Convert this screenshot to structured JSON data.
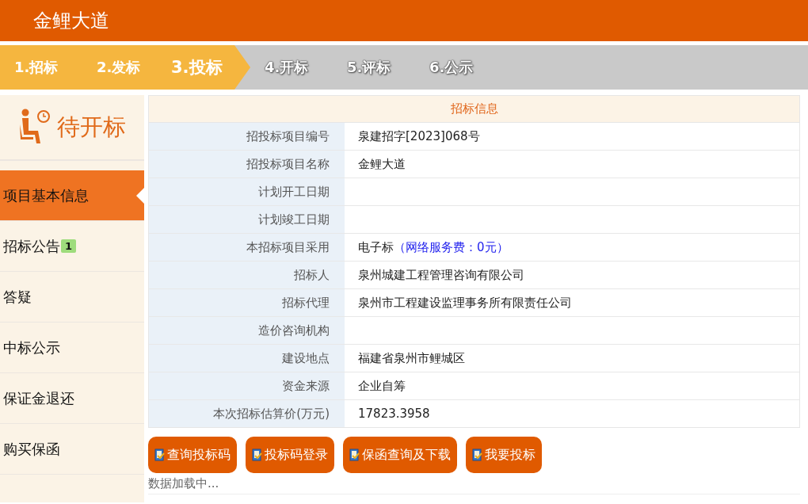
{
  "header": {
    "title": "金鲤大道"
  },
  "steps": [
    {
      "label": "1.招标",
      "reached": true,
      "selected": false
    },
    {
      "label": "2.发标",
      "reached": true,
      "selected": false
    },
    {
      "label": "3.投标",
      "reached": true,
      "selected": true
    },
    {
      "label": "4.开标",
      "reached": false,
      "selected": false
    },
    {
      "label": "5.评标",
      "reached": false,
      "selected": false
    },
    {
      "label": "6.公示",
      "reached": false,
      "selected": false
    }
  ],
  "status_card": {
    "label": "待开标"
  },
  "sidebar": {
    "items": [
      {
        "label": "项目基本信息",
        "selected": true
      },
      {
        "label": "招标公告",
        "selected": false,
        "badge": "1"
      },
      {
        "label": "答疑",
        "selected": false
      },
      {
        "label": "中标公示",
        "selected": false
      },
      {
        "label": "保证金退还",
        "selected": false
      },
      {
        "label": "购买保函",
        "selected": false
      }
    ]
  },
  "table": {
    "title": "招标信息",
    "rows": [
      {
        "label": "招投标项目编号",
        "value": "泉建招字[2023]068号"
      },
      {
        "label": "招投标项目名称",
        "value": "金鲤大道"
      },
      {
        "label": "计划开工日期"
      },
      {
        "label": "计划竣工日期"
      },
      {
        "label": "本招标项目采用",
        "value": "电子标",
        "note": "（网络服务费：0元）"
      },
      {
        "label": "招标人",
        "value": "泉州城建工程管理咨询有限公司"
      },
      {
        "label": "招标代理",
        "value": "泉州市工程建设监理事务所有限责任公司"
      },
      {
        "label": "造价咨询机构"
      },
      {
        "label": "建设地点",
        "value": "福建省泉州市鲤城区"
      },
      {
        "label": "资金来源",
        "value": "企业自筹"
      },
      {
        "label": "本次招标估算价(万元)",
        "value": "17823.3958"
      }
    ]
  },
  "actions": [
    "查询投标码",
    "投标码登录",
    "保函查询及下载",
    "我要投标"
  ],
  "loading_text": "数据加载中..."
}
